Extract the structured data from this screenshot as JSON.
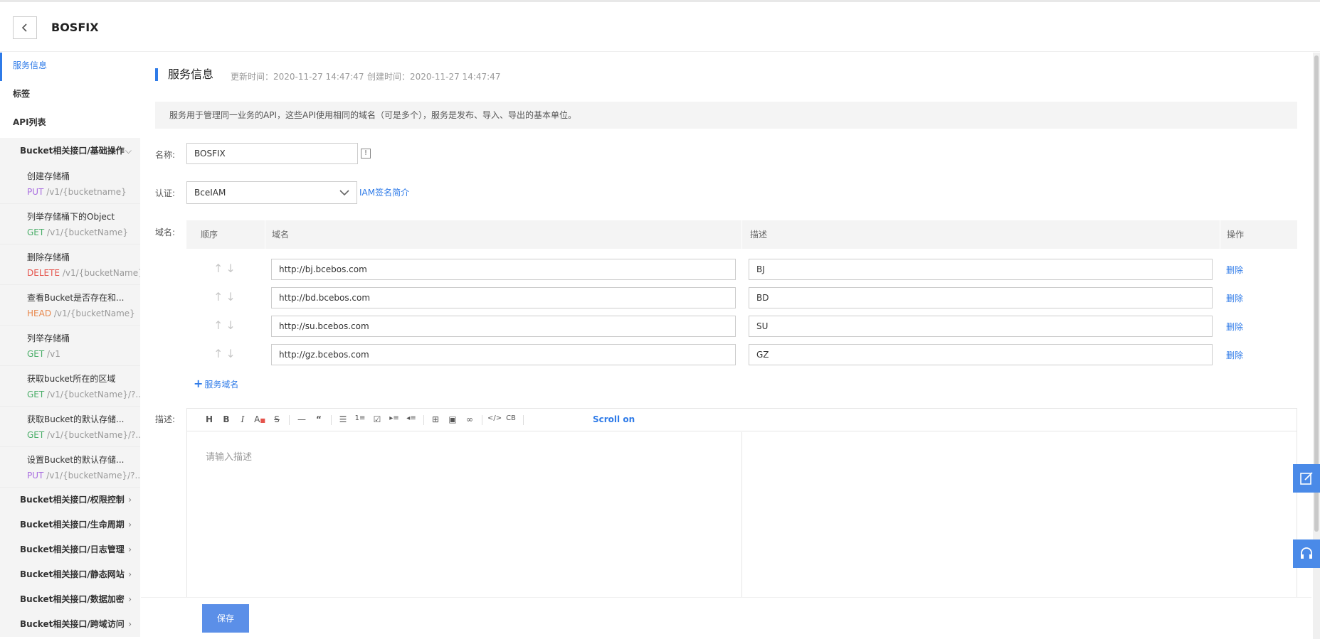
{
  "header": {
    "title": "BOSFIX"
  },
  "sidebar": {
    "top_items": [
      {
        "label": "服务信息"
      },
      {
        "label": "标签"
      },
      {
        "label": "API列表"
      }
    ],
    "expanded_group": {
      "label": "Bucket相关接口/基础操作",
      "apis": [
        {
          "name": "创建存储桶",
          "method": "PUT",
          "path": "/v1/{bucketname}"
        },
        {
          "name": "列举存储桶下的Object",
          "method": "GET",
          "path": "/v1/{bucketName}"
        },
        {
          "name": "删除存储桶",
          "method": "DELETE",
          "path": "/v1/{bucketName}"
        },
        {
          "name": "查看Bucket是否存在和...",
          "method": "HEAD",
          "path": "/v1/{bucketName}"
        },
        {
          "name": "列举存储桶",
          "method": "GET",
          "path": "/v1"
        },
        {
          "name": "获取bucket所在的区域",
          "method": "GET",
          "path": "/v1/{bucketName}/?..."
        },
        {
          "name": "获取Bucket的默认存储...",
          "method": "GET",
          "path": "/v1/{bucketName}/?..."
        },
        {
          "name": "设置Bucket的默认存储...",
          "method": "PUT",
          "path": "/v1/{bucketName}/?..."
        }
      ]
    },
    "collapsed_groups": [
      {
        "label": "Bucket相关接口/权限控制"
      },
      {
        "label": "Bucket相关接口/生命周期"
      },
      {
        "label": "Bucket相关接口/日志管理"
      },
      {
        "label": "Bucket相关接口/静态网站"
      },
      {
        "label": "Bucket相关接口/数据加密"
      },
      {
        "label": "Bucket相关接口/跨域访问"
      }
    ]
  },
  "main": {
    "section_title": "服务信息",
    "updated": "更新时间：2020-11-27 14:47:47",
    "created": "创建时间：2020-11-27 14:47:47",
    "notice": "服务用于管理同一业务的API，这些API使用相同的域名（可是多个），服务是发布、导入、导出的基本单位。",
    "name_label": "名称:",
    "name_value": "BOSFIX",
    "auth_label": "认证:",
    "auth_value": "BceIAM",
    "iam_link": "IAM签名简介",
    "domain_label": "域名:",
    "table_headers": {
      "order": "顺序",
      "domain": "域名",
      "desc": "描述",
      "ops": "操作"
    },
    "domains": [
      {
        "url": "http://bj.bcebos.com",
        "desc": "BJ",
        "delete": "删除"
      },
      {
        "url": "http://bd.bcebos.com",
        "desc": "BD",
        "delete": "删除"
      },
      {
        "url": "http://su.bcebos.com",
        "desc": "SU",
        "delete": "删除"
      },
      {
        "url": "http://gz.bcebos.com",
        "desc": "GZ",
        "delete": "删除"
      }
    ],
    "add_domain": "服务域名",
    "desc_label": "描述:",
    "editor": {
      "toolbar": [
        "H",
        "B",
        "I",
        "A",
        "S",
        "—",
        "“",
        "ul",
        "ol",
        "task",
        "indent",
        "outdent",
        "table",
        "image",
        "link",
        "code",
        "codeblock"
      ],
      "scroll_on": "Scroll on",
      "placeholder": "请输入描述"
    },
    "save": "保存"
  },
  "colors": {
    "accent": "#2f7be8",
    "put": "#a96ee0",
    "get": "#4cae6a",
    "delete": "#e5534b",
    "head": "#e8884d",
    "float": "#4a8ae8"
  }
}
